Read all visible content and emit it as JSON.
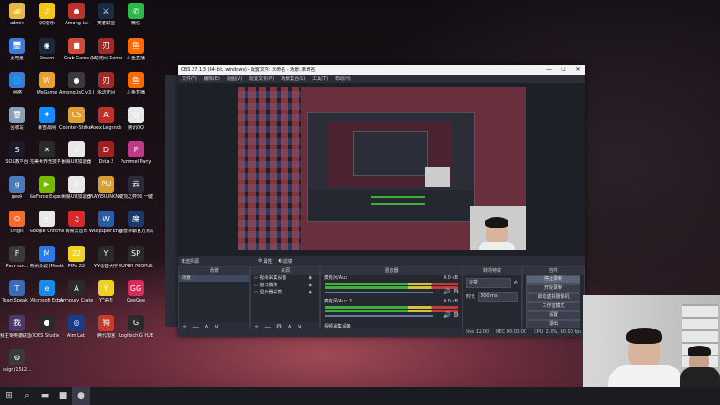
{
  "desktop": {
    "icons": [
      {
        "label": "admin",
        "glyph": "📁",
        "color": "#e6b84a"
      },
      {
        "label": "QQ音乐",
        "glyph": "♪",
        "color": "#f5c518"
      },
      {
        "label": "Among Us",
        "glyph": "●",
        "color": "#c0302a"
      },
      {
        "label": "英雄联盟",
        "glyph": "⚔",
        "color": "#1a2a40"
      },
      {
        "label": "微信",
        "glyph": "✆",
        "color": "#2db84a"
      },
      {
        "label": "此电脑",
        "glyph": "🖥",
        "color": "#3b7ad8"
      },
      {
        "label": "Steam",
        "glyph": "◉",
        "color": "#1b2838"
      },
      {
        "label": "Crab Game",
        "glyph": "■",
        "color": "#d04a3a"
      },
      {
        "label": "永劫无间 Demo",
        "glyph": "刃",
        "color": "#a02a2a"
      },
      {
        "label": "斗鱼直播",
        "glyph": "鱼",
        "color": "#ff6a00"
      },
      {
        "label": "网络",
        "glyph": "🌐",
        "color": "#3b7ad8"
      },
      {
        "label": "WeGame",
        "glyph": "W",
        "color": "#e8a030"
      },
      {
        "label": "AmongUsC v3.0.11.0",
        "glyph": "●",
        "color": "#3a3a3a"
      },
      {
        "label": "永劫无间",
        "glyph": "刃",
        "color": "#a02a2a"
      },
      {
        "label": "斗鱼直播",
        "glyph": "鱼",
        "color": "#ff6a00"
      },
      {
        "label": "回收站",
        "glyph": "🗑",
        "color": "#8aa0b8"
      },
      {
        "label": "暴雪战网",
        "glyph": "✦",
        "color": "#148eff"
      },
      {
        "label": "Counter-Strike Global Off...",
        "glyph": "CS",
        "color": "#e0a030"
      },
      {
        "label": "Apex Legends",
        "glyph": "A",
        "color": "#c0302a"
      },
      {
        "label": "腾讯QQ",
        "glyph": "Q",
        "color": "#e8e8e8"
      },
      {
        "label": "SOS救平台",
        "glyph": "S",
        "color": "#1a1a2a"
      },
      {
        "label": "完美世界竞技平台",
        "glyph": "✕",
        "color": "#2a2a2a"
      },
      {
        "label": "网易UU加速器",
        "glyph": "U",
        "color": "#e8e8e8"
      },
      {
        "label": "Dota 2",
        "glyph": "D",
        "color": "#a02020"
      },
      {
        "label": "Pummel Party",
        "glyph": "P",
        "color": "#c03a8a"
      },
      {
        "label": "geek",
        "glyph": "g",
        "color": "#4a7ab8"
      },
      {
        "label": "GeForce Experience",
        "glyph": "▶",
        "color": "#76b900"
      },
      {
        "label": "网易UU加速器",
        "glyph": "U",
        "color": "#e8e8e8"
      },
      {
        "label": "PLAYERUNKNOWN'S BATTLEGROUNDS",
        "glyph": "PU",
        "color": "#d8a030"
      },
      {
        "label": "云顶之弈S6 一键工具",
        "glyph": "云",
        "color": "#2a2a3a"
      },
      {
        "label": "Origin",
        "glyph": "O",
        "color": "#f56c2d"
      },
      {
        "label": "Google Chrome",
        "glyph": "◎",
        "color": "#e8e8e8"
      },
      {
        "label": "网易云音乐",
        "glyph": "♫",
        "color": "#d8282a"
      },
      {
        "label": "Wallpaper Engine: ...",
        "glyph": "W",
        "color": "#2a5aa8"
      },
      {
        "label": "魔兽争霸官方对战平台",
        "glyph": "魔",
        "color": "#1a3a6a"
      },
      {
        "label": "Fear sur...",
        "glyph": "F",
        "color": "#3a3a3a"
      },
      {
        "label": "腾讯会议 (Meeting)",
        "glyph": "M",
        "color": "#2a7ae8"
      },
      {
        "label": "FIFA 22",
        "glyph": "22",
        "color": "#f0d020"
      },
      {
        "label": "YY语音大厅",
        "glyph": "Y",
        "color": "#2a2a2a"
      },
      {
        "label": "SUPER PEOPLE.CBT",
        "glyph": "SP",
        "color": "#2a2a2a"
      },
      {
        "label": "TeamSpeak 3",
        "glyph": "T",
        "color": "#3a6ab8"
      },
      {
        "label": "Microsoft Edge",
        "glyph": "e",
        "color": "#1a8ae8"
      },
      {
        "label": "Armoury Crate",
        "glyph": "A",
        "color": "#2a2a2a"
      },
      {
        "label": "YY语音",
        "glyph": "Y",
        "color": "#f0d020"
      },
      {
        "label": "GeeGee",
        "glyph": "GG",
        "color": "#d82a5a"
      },
      {
        "label": "我主宰英雄联盟(NTPLAY...",
        "glyph": "我",
        "color": "#4a3a6a"
      },
      {
        "label": "OBS Studio",
        "glyph": "●",
        "color": "#2a2a2a"
      },
      {
        "label": "Aim Lab",
        "glyph": "◎",
        "color": "#1a3a8a"
      },
      {
        "label": "腾讯加速",
        "glyph": "腾",
        "color": "#c83a2a"
      },
      {
        "label": "Logitech G HUB",
        "glyph": "G",
        "color": "#2a2a2a"
      },
      {
        "label": "(sign)1512...",
        "glyph": "⚙",
        "color": "#3a3a3a"
      }
    ]
  },
  "taskbar": {
    "items": [
      {
        "name": "windows-start-icon",
        "glyph": "⊞"
      },
      {
        "name": "search-icon",
        "glyph": "⌕"
      },
      {
        "name": "file-explorer-icon",
        "glyph": "▬"
      },
      {
        "name": "app-icon",
        "glyph": "■"
      },
      {
        "name": "obs-taskbar-icon",
        "glyph": "●"
      }
    ]
  },
  "obs": {
    "title": "OBS 27.1.3 (64-bit, windows) - 配置文件: 未命名 - 场景: 未命名",
    "menu": [
      "文件(F)",
      "编辑(E)",
      "视图(V)",
      "配置文件(P)",
      "场景集合(S)",
      "工具(T)",
      "帮助(H)"
    ],
    "controls": {
      "minimize": "—",
      "maximize": "☐",
      "close": "✕"
    },
    "source_bar": {
      "label": "未选择源",
      "properties": "属性",
      "filters": "滤镜"
    },
    "docks": {
      "scenes": {
        "title": "场景",
        "items": [
          "场景"
        ],
        "footer": [
          "+",
          "—",
          "∧",
          "∨"
        ]
      },
      "sources": {
        "title": "来源",
        "items": [
          "视频采集设备",
          "窗口捕获",
          "显示器采集"
        ],
        "footer": [
          "+",
          "—",
          "⚙",
          "∧",
          "∨"
        ]
      },
      "mixer": {
        "title": "混音器",
        "tracks": [
          {
            "name": "麦克风/Aux",
            "db": "0.0 dB",
            "fill": 0.62
          },
          {
            "name": "麦克风/Aux 2",
            "db": "0.0 dB",
            "fill": 0.62
          }
        ],
        "footer": "视频采集设备"
      },
      "transitions": {
        "title": "转场特效",
        "type": "淡变",
        "duration_label": "时长",
        "duration": "300 ms"
      },
      "controls": {
        "title": "控件",
        "buttons": [
          "停止录制",
          "开始录制",
          "启动虚拟摄像机",
          "工作室模式",
          "设置",
          "退出"
        ]
      }
    },
    "status": [
      "live 12:00",
      "REC 00:00:00",
      "CPU: 2.0%, 60.00 fps"
    ]
  }
}
